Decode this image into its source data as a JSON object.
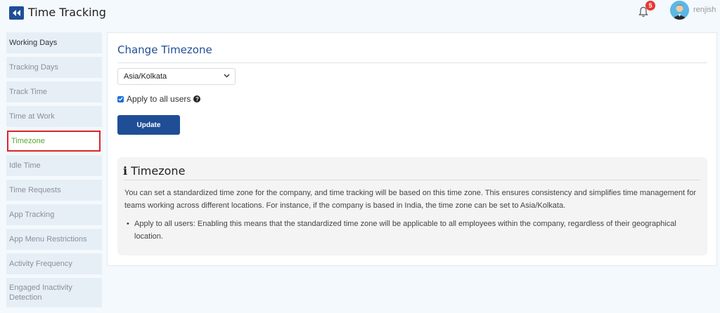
{
  "header": {
    "title": "Time Tracking",
    "notification_count": "5",
    "username": "renjish"
  },
  "sidebar": {
    "items": [
      {
        "label": "Working Days"
      },
      {
        "label": "Tracking Days"
      },
      {
        "label": "Track Time"
      },
      {
        "label": "Time at Work"
      },
      {
        "label": "Timezone"
      },
      {
        "label": "Idle Time"
      },
      {
        "label": "Time Requests"
      },
      {
        "label": "App Tracking"
      },
      {
        "label": "App Menu Restrictions"
      },
      {
        "label": "Activity Frequency"
      },
      {
        "label": "Engaged Inactivity Detection"
      }
    ],
    "active": "Timezone"
  },
  "main": {
    "title": "Change Timezone",
    "timezone_value": "Asia/Kolkata",
    "apply_label": "Apply to all users",
    "apply_checked": true,
    "update_label": "Update"
  },
  "info": {
    "title": "Timezone",
    "paragraph": "You can set a standardized time zone for the company, and time tracking will be based on this time zone. This ensures consistency and simplifies time management for teams working across different locations. For instance, if the company is based in India, the time zone can be set to Asia/Kolkata.",
    "bullet": "Apply to all users: Enabling this means that the standardized time zone will be applicable to all employees within the company, regardless of their geographical location."
  },
  "colors": {
    "brand": "#1f4e96",
    "active_text": "#5aa832",
    "active_border": "#d9262b",
    "badge": "#e53935"
  },
  "icons": [
    "back-icon",
    "bell-icon",
    "chevron-down-icon",
    "question-icon",
    "info-icon",
    "checkmark-icon"
  ]
}
